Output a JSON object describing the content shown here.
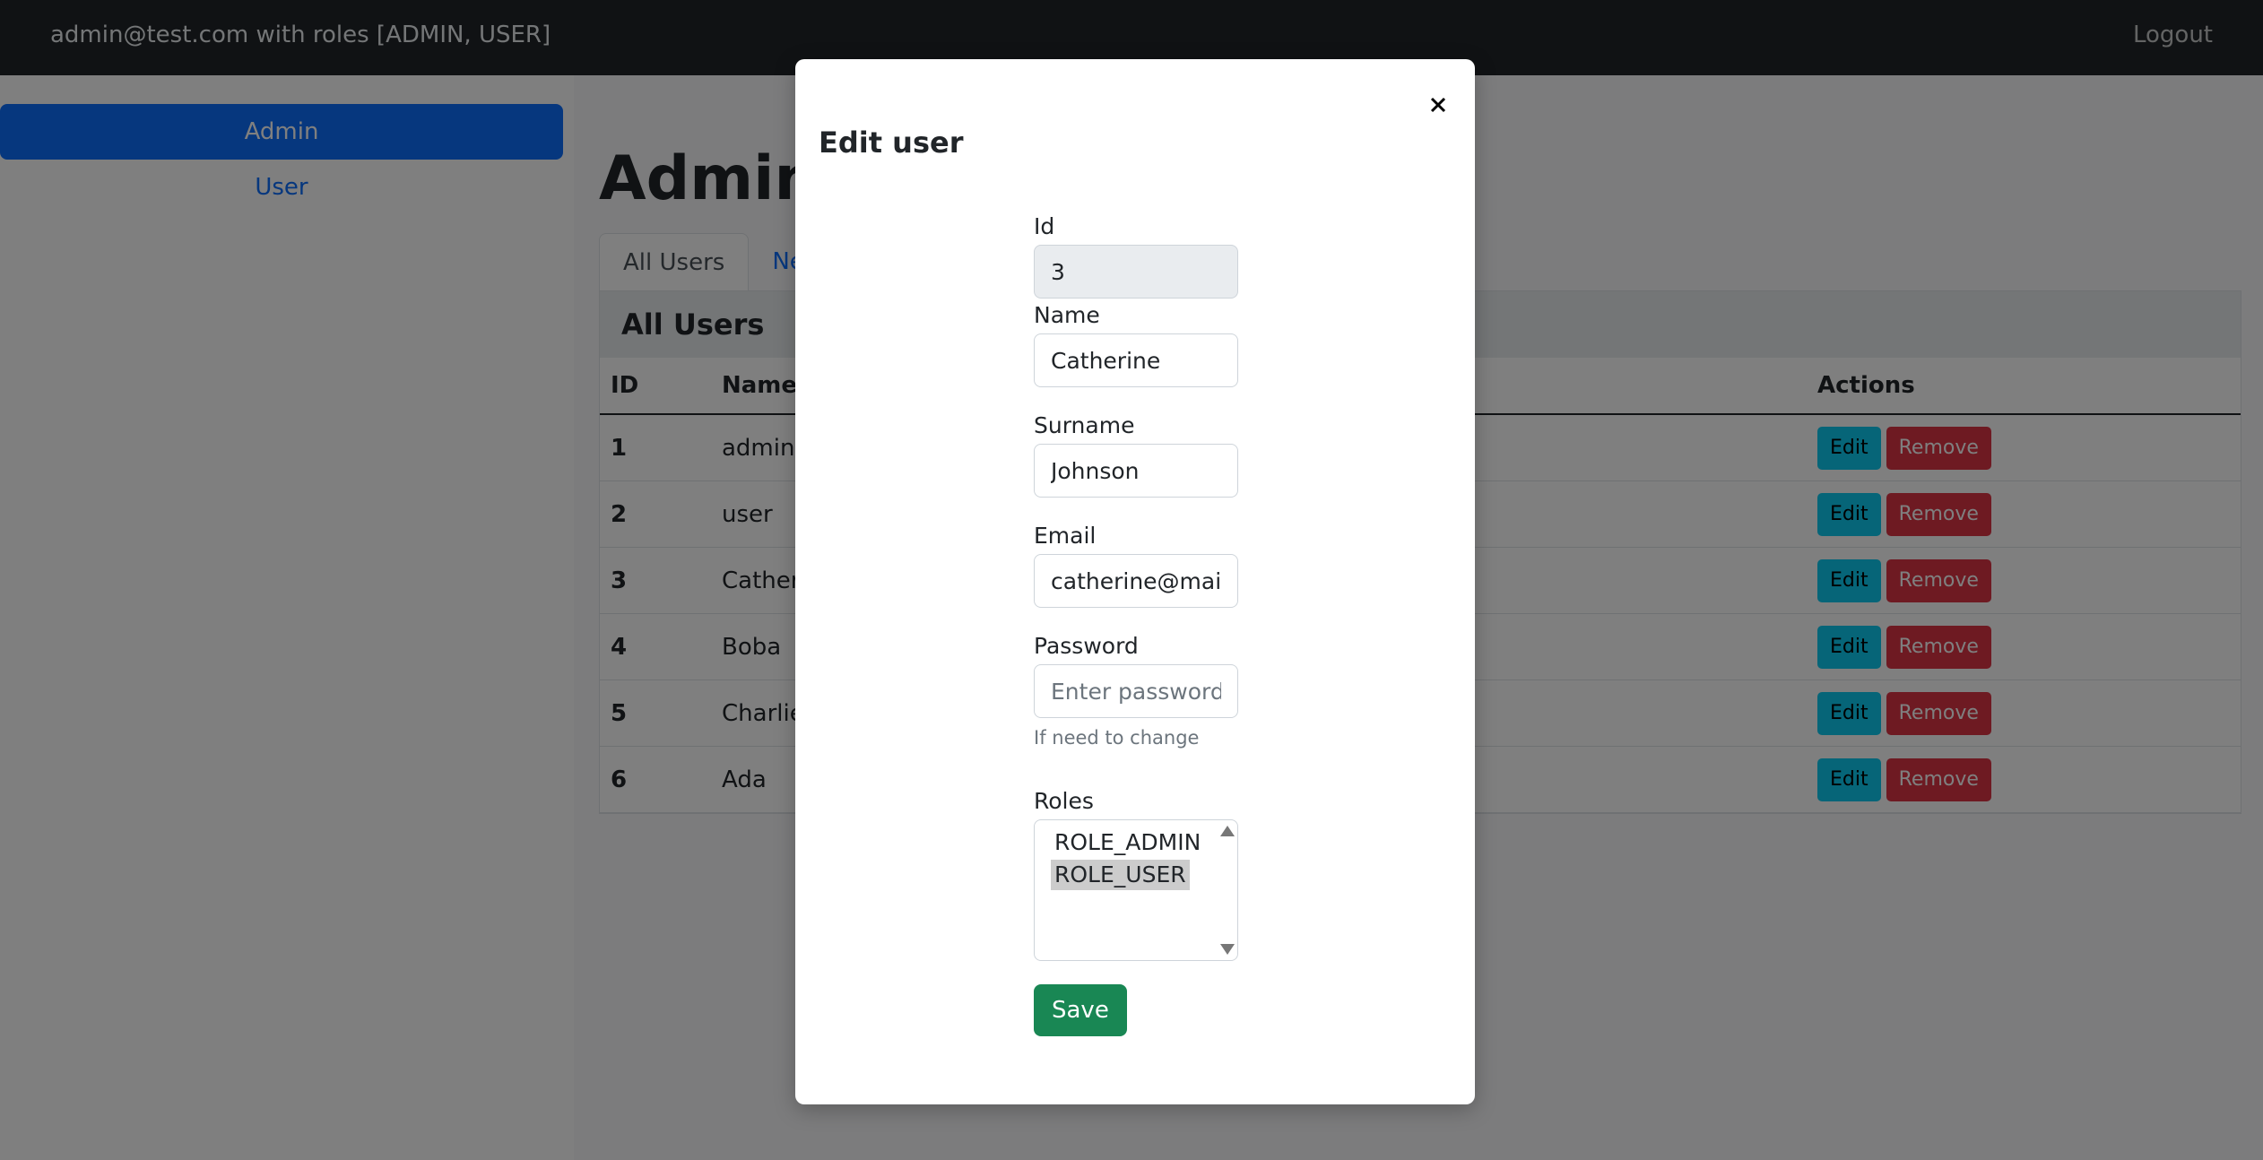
{
  "navbar": {
    "user_info": "admin@test.com with roles [ADMIN, USER]",
    "logout": "Logout"
  },
  "sidebar": {
    "items": [
      {
        "label": "Admin"
      },
      {
        "label": "User"
      }
    ]
  },
  "main": {
    "title": "Admin panel",
    "tabs": [
      {
        "label": "All Users"
      },
      {
        "label": "New User"
      }
    ],
    "card_title": "All Users",
    "columns": [
      "ID",
      "Name",
      "Actions"
    ],
    "rows": [
      {
        "id": "1",
        "name": "admin"
      },
      {
        "id": "2",
        "name": "user"
      },
      {
        "id": "3",
        "name": "Catherine"
      },
      {
        "id": "4",
        "name": "Boba"
      },
      {
        "id": "5",
        "name": "Charlie"
      },
      {
        "id": "6",
        "name": "Ada"
      }
    ],
    "edit_label": "Edit",
    "remove_label": "Remove"
  },
  "modal": {
    "title": "Edit user",
    "id_label": "Id",
    "id_value": "3",
    "name_label": "Name",
    "name_value": "Catherine",
    "surname_label": "Surname",
    "surname_value": "Johnson",
    "email_label": "Email",
    "email_value": "catherine@mail.com",
    "password_label": "Password",
    "password_placeholder": "Enter password",
    "password_help": "If need to change",
    "roles_label": "Roles",
    "roles": [
      "ROLE_ADMIN",
      "ROLE_USER"
    ],
    "save_label": "Save"
  }
}
